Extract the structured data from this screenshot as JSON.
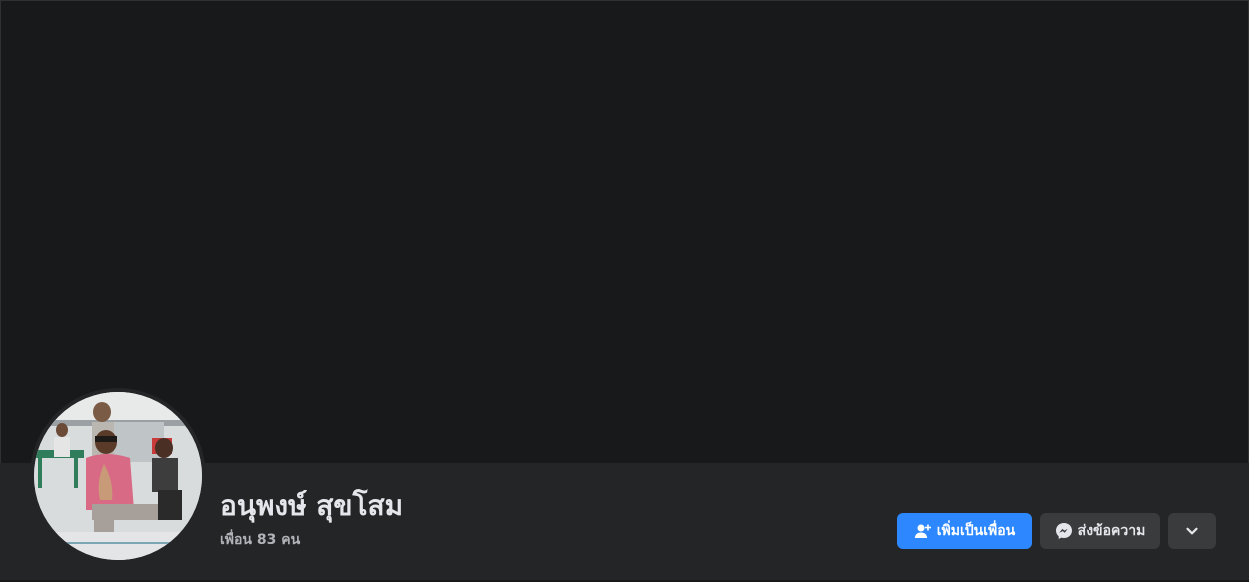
{
  "profile": {
    "name": "อนุพงษ์ สุขโสม",
    "friends_text": "เพื่อน 83 คน",
    "avatar_icon": "profile-photo"
  },
  "actions": {
    "add_friend_label": "เพิ่มเป็นเพื่อน",
    "add_friend_icon": "add-friend-icon",
    "message_label": "ส่งข้อความ",
    "message_icon": "messenger-icon",
    "more_icon": "chevron-down-icon"
  },
  "colors": {
    "background": "#18191a",
    "surface": "#242526",
    "primary_button": "#2d88ff",
    "secondary_button": "#3a3b3c",
    "text_primary": "#e4e6eb",
    "text_secondary": "#b0b3b8"
  }
}
